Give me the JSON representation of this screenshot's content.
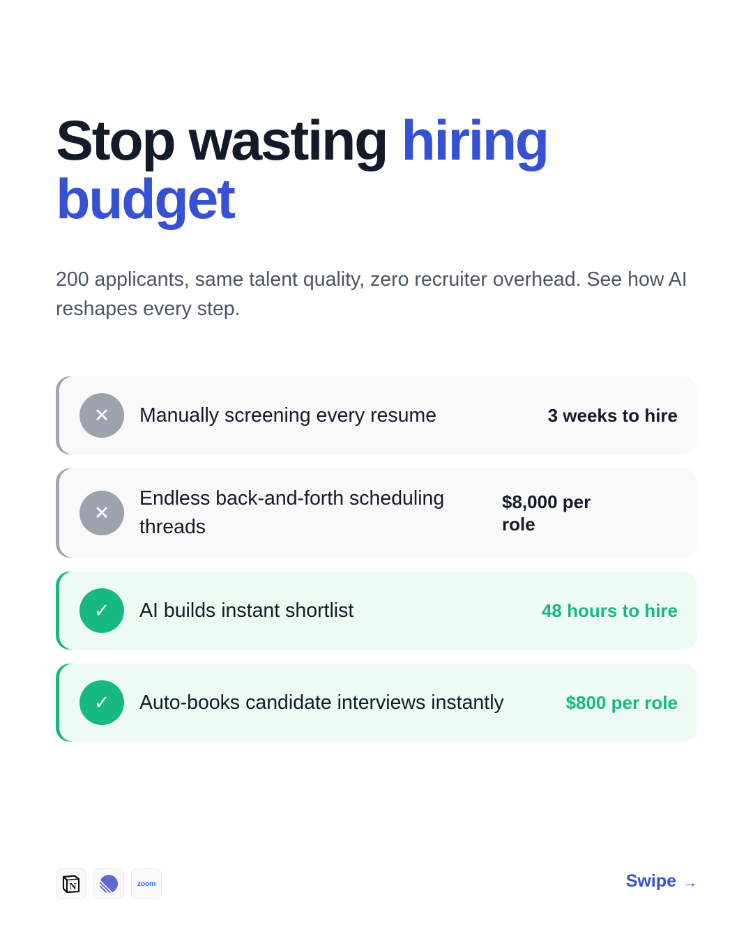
{
  "headline": {
    "text_dark": "Stop wasting ",
    "text_accent_1": "hiring",
    "text_accent_2": "budget"
  },
  "subtitle": "200 applicants, same talent quality, zero recruiter overhead. See how AI reshapes every step.",
  "comparisons": [
    {
      "status": "before",
      "icon": "close-icon",
      "icon_glyph": "✕",
      "label": "Manually screening every resume",
      "value": "3 weeks to hire"
    },
    {
      "status": "before",
      "icon": "close-icon",
      "icon_glyph": "✕",
      "label": "Endless back-and-forth scheduling threads",
      "value": "$8,000 per role"
    },
    {
      "status": "after",
      "icon": "check-icon",
      "icon_glyph": "✓",
      "label": "AI builds instant shortlist",
      "value": "48 hours to hire"
    },
    {
      "status": "after",
      "icon": "check-icon",
      "icon_glyph": "✓",
      "label": "Auto-books candidate interviews instantly",
      "value": "$800 per role"
    }
  ],
  "logos": [
    {
      "name": "notion-logo",
      "glyph": "N"
    },
    {
      "name": "linear-logo"
    },
    {
      "name": "zoom-logo",
      "text": "zoom"
    }
  ],
  "footer": {
    "swipe_label": "Swipe",
    "swipe_arrow": "→"
  },
  "colors": {
    "headline": "#131a29",
    "accent": "#3651d4",
    "success": "#16b97f",
    "muted_badge": "#9ca3af",
    "before_bg": "#f9f9fa",
    "after_bg": "#edfbf2"
  }
}
